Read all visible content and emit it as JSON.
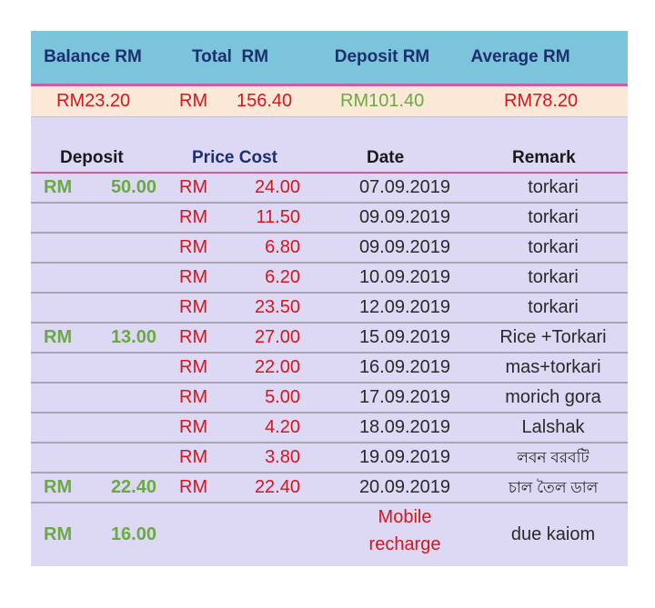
{
  "header": {
    "balance": "Balance RM",
    "total": "Total  RM",
    "deposit": "Deposit RM",
    "average": "Average RM"
  },
  "summary": {
    "balance": "RM23.20",
    "total_cur": "RM",
    "total_amt": "156.40",
    "deposit": "RM101.40",
    "average": "RM78.20"
  },
  "colors": {
    "header_bg": "#7cc3dc",
    "summary_bg": "#fce8d6",
    "body_bg": "#ddd8f4",
    "deposit_green": "#6aa944",
    "price_red": "#d8141c",
    "accent_pink": "#d05c9a"
  },
  "columns": {
    "deposit": "Deposit",
    "price_cost": "Price Cost",
    "date": "Date",
    "remark": "Remark"
  },
  "rows": [
    {
      "dep_cur": "RM",
      "dep_amt": "50.00",
      "price_cur": "RM",
      "price_amt": "24.00",
      "date": "07.09.2019",
      "remark": "torkari"
    },
    {
      "dep_cur": "",
      "dep_amt": "",
      "price_cur": "RM",
      "price_amt": "11.50",
      "date": "09.09.2019",
      "remark": "torkari"
    },
    {
      "dep_cur": "",
      "dep_amt": "",
      "price_cur": "RM",
      "price_amt": "6.80",
      "date": "09.09.2019",
      "remark": "torkari"
    },
    {
      "dep_cur": "",
      "dep_amt": "",
      "price_cur": "RM",
      "price_amt": "6.20",
      "date": "10.09.2019",
      "remark": "torkari"
    },
    {
      "dep_cur": "",
      "dep_amt": "",
      "price_cur": "RM",
      "price_amt": "23.50",
      "date": "12.09.2019",
      "remark": "torkari"
    },
    {
      "dep_cur": "RM",
      "dep_amt": "13.00",
      "price_cur": "RM",
      "price_amt": "27.00",
      "date": "15.09.2019",
      "remark": "Rice +Torkari"
    },
    {
      "dep_cur": "",
      "dep_amt": "",
      "price_cur": "RM",
      "price_amt": "22.00",
      "date": "16.09.2019",
      "remark": "mas+torkari"
    },
    {
      "dep_cur": "",
      "dep_amt": "",
      "price_cur": "RM",
      "price_amt": "5.00",
      "date": "17.09.2019",
      "remark": "morich gora"
    },
    {
      "dep_cur": "",
      "dep_amt": "",
      "price_cur": "RM",
      "price_amt": "4.20",
      "date": "18.09.2019",
      "remark": "Lalshak"
    },
    {
      "dep_cur": "",
      "dep_amt": "",
      "price_cur": "RM",
      "price_amt": "3.80",
      "date": "19.09.2019",
      "remark": "লবন বরবটি"
    },
    {
      "dep_cur": "RM",
      "dep_amt": "22.40",
      "price_cur": "RM",
      "price_amt": "22.40",
      "date": "20.09.2019",
      "remark": "চাল তৈল ডাল"
    }
  ],
  "last_row": {
    "dep_cur": "RM",
    "dep_amt": "16.00",
    "date_line1": "Mobile",
    "date_line2": "recharge",
    "remark": "due kaiom"
  }
}
